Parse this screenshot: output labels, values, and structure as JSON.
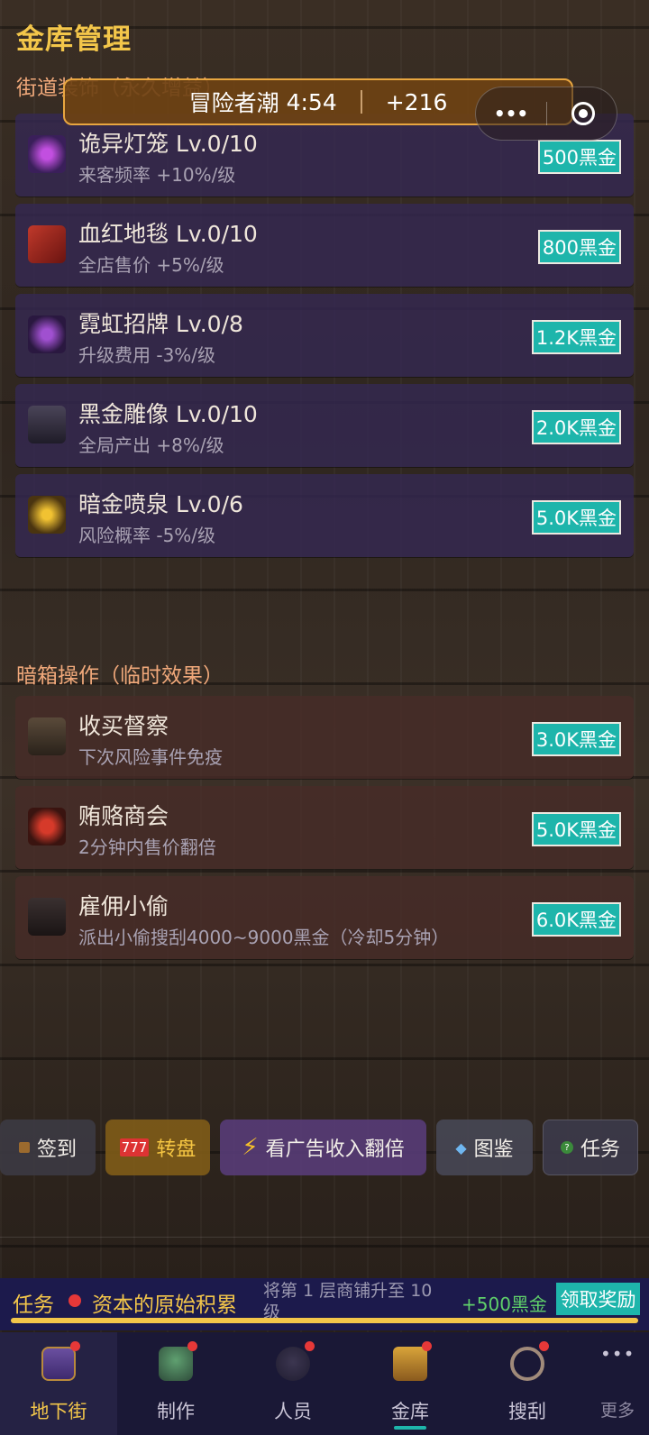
{
  "page_title": "金库管理",
  "sections": {
    "street_decor": "街道装饰（永久增益）",
    "secret_ops": "暗箱操作（临时效果）"
  },
  "event_banner": {
    "event_name": "冒险者潮",
    "timer": "4:54",
    "bonus": "+216"
  },
  "capsule": {
    "more_glyph": "•••"
  },
  "decor_items": [
    {
      "name": "诡异灯笼 Lv.0/10",
      "desc": "来客频率 +10%/级",
      "price": "500黑金",
      "icon": "lantern-icon"
    },
    {
      "name": "血红地毯 Lv.0/10",
      "desc": "全店售价 +5%/级",
      "price": "800黑金",
      "icon": "carpet-icon"
    },
    {
      "name": "霓虹招牌 Lv.0/8",
      "desc": "升级费用 -3%/级",
      "price": "1.2K黑金",
      "icon": "neon-sign-icon"
    },
    {
      "name": "黑金雕像 Lv.0/10",
      "desc": "全局产出 +8%/级",
      "price": "2.0K黑金",
      "icon": "statue-icon"
    },
    {
      "name": "暗金喷泉 Lv.0/6",
      "desc": "风险概率 -5%/级",
      "price": "5.0K黑金",
      "icon": "fountain-icon"
    }
  ],
  "ops_items": [
    {
      "name": "收买督察",
      "desc": "下次风险事件免疫",
      "price": "3.0K黑金",
      "icon": "inspector-icon"
    },
    {
      "name": "贿赂商会",
      "desc": "2分钟内售价翻倍",
      "price": "5.0K黑金",
      "icon": "guild-icon"
    },
    {
      "name": "雇佣小偷",
      "desc": "派出小偷搜刮4000~9000黑金（冷却5分钟）",
      "price": "6.0K黑金",
      "icon": "thief-icon"
    }
  ],
  "toolbar": {
    "checkin": "签到",
    "wheel": "转盘",
    "ad_double": "看广告收入翻倍",
    "codex": "图鉴",
    "tasks": "任务"
  },
  "task_bar": {
    "label": "任务",
    "name": "资本的原始积累",
    "desc": "将第 1 层商铺升至 10 级",
    "reward": "+500黑金",
    "claim": "领取奖励",
    "progress": 1.0
  },
  "nav": [
    {
      "label": "地下街",
      "active": true
    },
    {
      "label": "制作"
    },
    {
      "label": "人员"
    },
    {
      "label": "金库",
      "selected": true
    },
    {
      "label": "搜刮"
    },
    {
      "label": "更多"
    }
  ],
  "colors": {
    "accent_gold": "#f3c64a",
    "price_teal": "#1eb5ab",
    "section_orange": "#f0a87a",
    "badge_red": "#e63838"
  }
}
